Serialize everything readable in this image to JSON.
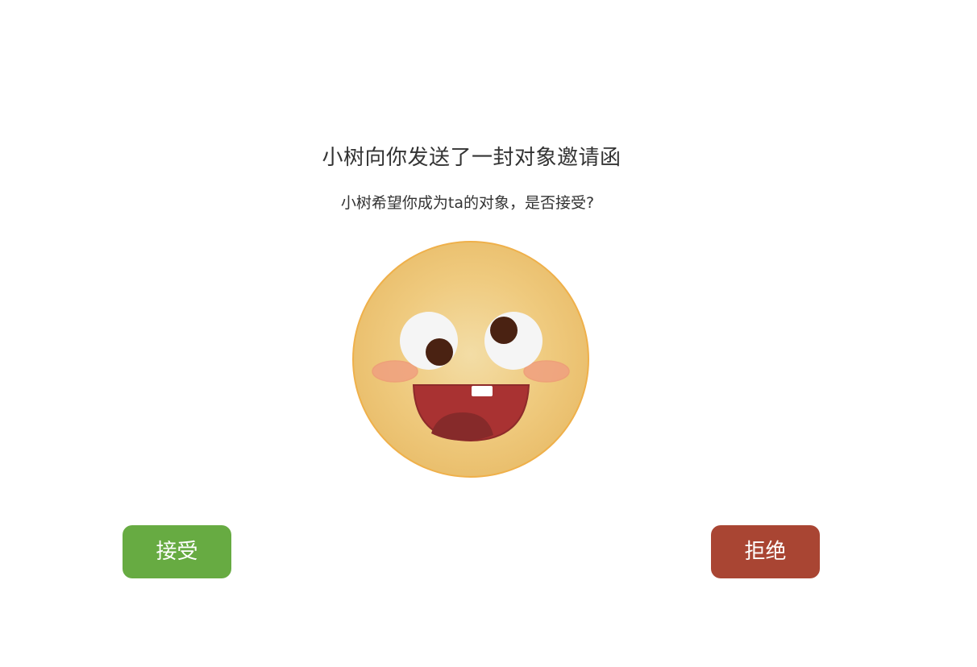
{
  "invitation": {
    "title": "小树向你发送了一封对象邀请函",
    "subtitle": "小树希望你成为ta的对象，是否接受?"
  },
  "emoji": {
    "icon": "laughing-face-icon",
    "face_color": "#f0c878",
    "outline_color": "#efb04a",
    "cheek_color": "#f0a080",
    "mouth_color": "#a93232"
  },
  "actions": {
    "accept_label": "接受",
    "reject_label": "拒绝",
    "accept_color": "#67ab42",
    "reject_color": "#a94533"
  }
}
